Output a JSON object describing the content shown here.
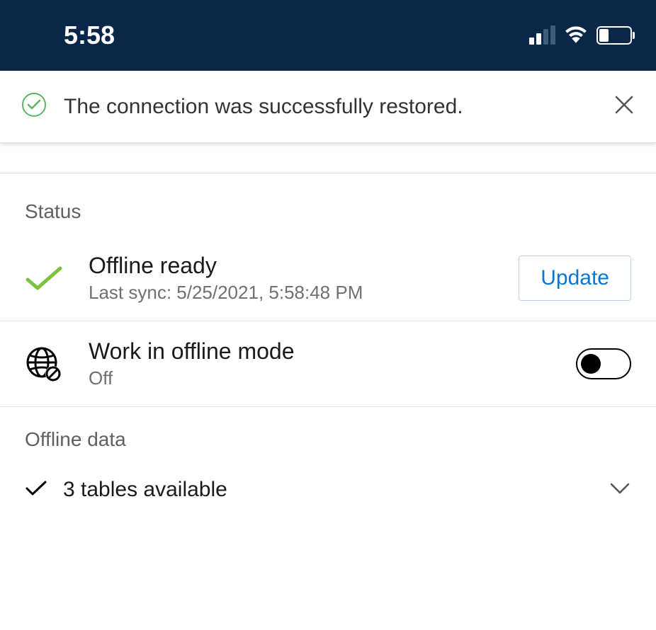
{
  "statusBar": {
    "time": "5:58"
  },
  "notification": {
    "text": "The connection was successfully restored."
  },
  "status": {
    "header": "Status",
    "offlineReady": {
      "title": "Offline ready",
      "subtitle": "Last sync: 5/25/2021, 5:58:48 PM",
      "buttonLabel": "Update"
    },
    "offlineMode": {
      "title": "Work in offline mode",
      "state": "Off"
    }
  },
  "offlineData": {
    "header": "Offline data",
    "tablesText": "3 tables available"
  }
}
